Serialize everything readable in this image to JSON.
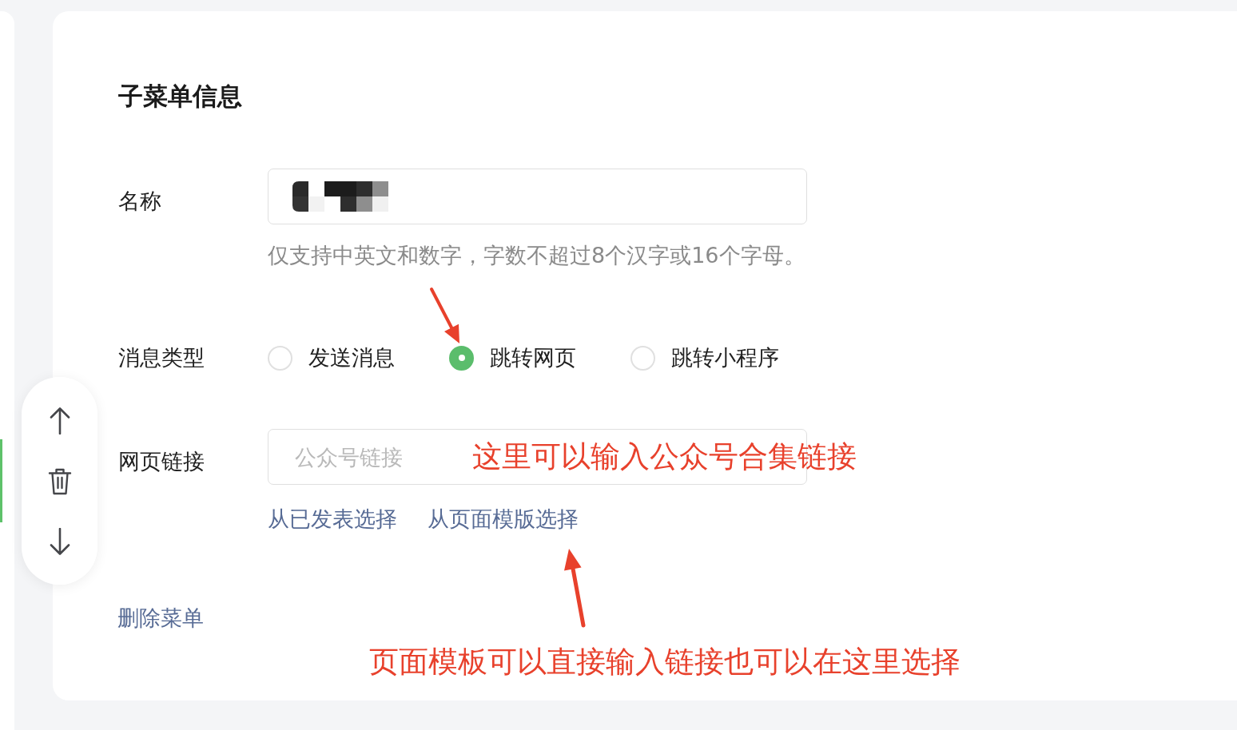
{
  "left_panel": {
    "item_selected": true
  },
  "form": {
    "title": "子菜单信息",
    "fields": [
      {
        "kind": "text",
        "label": "名称",
        "value_redacted": true,
        "hint": "仅支持中英文和数字，字数不超过8个汉字或16个字母。"
      },
      {
        "kind": "radio",
        "label": "消息类型",
        "options": [
          {
            "label": "发送消息",
            "selected": false
          },
          {
            "label": "跳转网页",
            "selected": true
          },
          {
            "label": "跳转小程序",
            "selected": false
          }
        ]
      },
      {
        "kind": "link",
        "label": "网页链接",
        "placeholder": "公众号链接",
        "links": [
          "从已发表选择",
          "从页面模版选择"
        ]
      }
    ],
    "delete_link": "删除菜单"
  },
  "annotations": [
    {
      "text": "这里可以输入公众号合集链接"
    },
    {
      "text": "页面模板可以直接输入链接也可以在这里选择"
    }
  ]
}
